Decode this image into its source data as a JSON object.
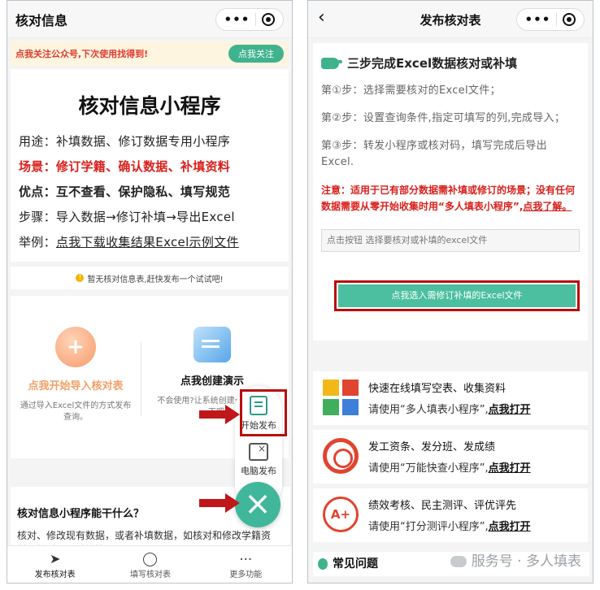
{
  "left": {
    "title": "核对信息",
    "banner_text": "点我关注公众号,下次使用找得到!",
    "follow_button": "点我关注",
    "intro_title": "核对信息小程序",
    "intro_rows": [
      "用途：补填数据、修订数据专用小程序",
      "场景：修订学籍、确认数据、补填资料",
      "优点：互不查看、保护隐私、填写规范",
      "步骤：导入数据→修订补填→导出Excel",
      "举例："
    ],
    "example_link": "点我下载收集结果Excel示例文件",
    "notice": "暂无核对信息表,赶快发布一个试试吧!",
    "action1_title": "点我开始导入核对表",
    "action1_desc": "通过导入Excel文件的方式发布查询。",
    "action2_title": "点我创建演示",
    "action2_desc": "不会使用?让系统创建一个体验一下吧",
    "fab_item1": "开始发布",
    "fab_item2": "电脑发布",
    "fab_icon": "close-icon",
    "what_title": "核对信息小程序能干什么？",
    "what_desc": "核对、修改现有数据，或者补填数据，如核对和修改学籍资料，核对通讯地址等。",
    "tabs": [
      {
        "label": "发布核对表",
        "icon": "paper-plane-icon"
      },
      {
        "label": "填写核对表",
        "icon": "search-icon"
      },
      {
        "label": "更多功能",
        "icon": "more-icon"
      }
    ],
    "colors": {
      "accent": "#40b79b",
      "red": "#d8201c",
      "highlight_box": "#b80d0d"
    }
  },
  "right": {
    "title": "发布核对表",
    "heading": "三步完成Excel数据核对或补填",
    "steps": [
      "第①步：选择需要核对的Excel文件；",
      "第②步：设置查询条件,指定可填写的列,完成导入；",
      "第③步：转发小程序或核对码，填写完成后导出Excel."
    ],
    "warning": "注意：适用于已有部分数据需补填或修订的场景；没有任何数据需要从零开始收集时用“多人填表小程序”,",
    "warning_link": "点我了解。",
    "file_placeholder": "点击按钮 选择要核对或补填的excel文件",
    "choose_button": "点我选入需修订补填的Excel文件",
    "cards": [
      {
        "title": "快速在线填写空表、收集资料",
        "use": "请使用“多人填表小程序”,",
        "link": "点我打开",
        "icon": "grid-blocks-icon"
      },
      {
        "title": "发工资条、发分班、发成绩",
        "use": "请使用“万能快查小程序”,",
        "link": "点我打开",
        "icon": "target-icon"
      },
      {
        "title": "绩效考核、民主测评、评优评先",
        "use": "请使用“打分测评小程序”,",
        "link": "点我打开",
        "icon": "grade-a-plus-icon"
      }
    ],
    "faq": "常见问题",
    "watermark": "服务号 · 多人填表"
  }
}
